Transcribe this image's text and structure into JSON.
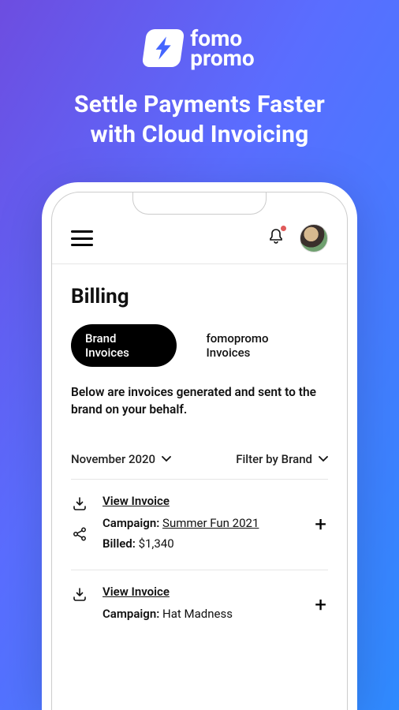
{
  "brand": {
    "name_line1": "fomo",
    "name_line2": "promo"
  },
  "headline_line1": "Settle Payments Faster",
  "headline_line2": "with Cloud Invoicing",
  "page": {
    "title": "Billing",
    "tabs": {
      "active": "Brand Invoices",
      "secondary": "fomopromo Invoices"
    },
    "description": "Below are invoices generated and sent to the brand on your behalf.",
    "filters": {
      "date": "November 2020",
      "brand": "Filter by Brand"
    },
    "invoices": [
      {
        "view_label": "View Invoice",
        "campaign_label": "Campaign",
        "campaign_name": "Summer Fun 2021",
        "campaign_underlined": true,
        "billed_label": "Billed",
        "billed_value": "$1,340",
        "show_share": true
      },
      {
        "view_label": "View Invoice",
        "campaign_label": "Campaign",
        "campaign_name": "Hat Madness",
        "campaign_underlined": false,
        "billed_label": "",
        "billed_value": "",
        "show_share": false
      }
    ]
  },
  "icons": {
    "menu": "menu-icon",
    "bell": "bell-icon",
    "avatar": "avatar",
    "download": "download-icon",
    "share": "share-icon",
    "chevron_down": "chevron-down-icon",
    "plus": "+"
  }
}
